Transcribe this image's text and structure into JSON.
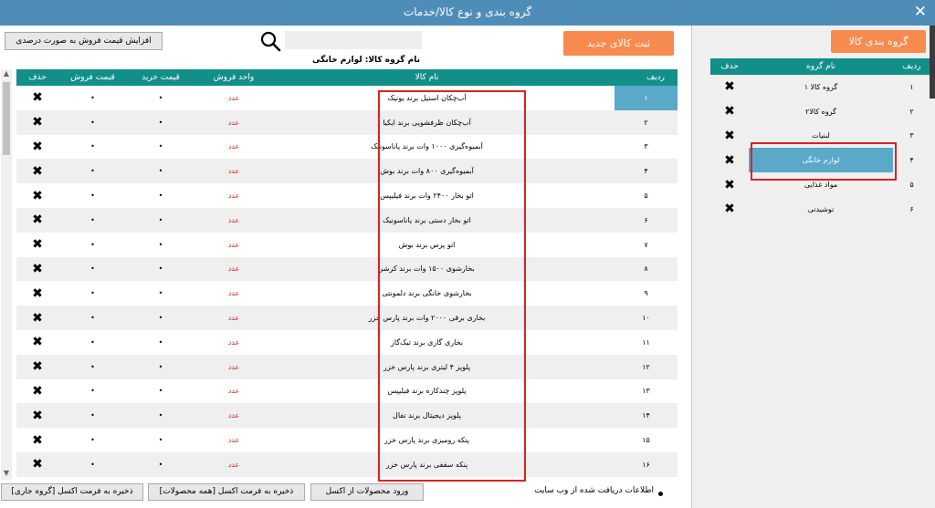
{
  "window": {
    "title": "گروه بندی و نوع کالا/خدمات",
    "close_glyph": "✕"
  },
  "toolbar": {
    "percent_price_button": "افزایش قیمت فروش به صورت درصدی",
    "search_placeholder": "",
    "new_item_button": "ثبت کالای جدید"
  },
  "group_caption": "نام گروه کالا: لوازم خانگی",
  "products_table": {
    "columns": {
      "delete": "حذف",
      "sale_price": "قیمت فروش",
      "buy_price": "قیمت خرید",
      "unit": "واحد فروش",
      "name": "نام کالا",
      "row": "ردیف"
    },
    "rows": [
      {
        "row": "۱",
        "name": "آب‌چکان استیل برند یونیک",
        "unit": "عدد",
        "buy": "•",
        "sale": "•",
        "del": "✖"
      },
      {
        "row": "۲",
        "name": "آب‌چکان ظرفشویی برند ایکیا",
        "unit": "عدد",
        "buy": "•",
        "sale": "•",
        "del": "✖"
      },
      {
        "row": "۳",
        "name": "آبمیوه‌گیری ۱۰۰۰ وات برند پاناسونیک",
        "unit": "عدد",
        "buy": "•",
        "sale": "•",
        "del": "✖"
      },
      {
        "row": "۴",
        "name": "آبمیوه‌گیری ۸۰۰ وات برند بوش",
        "unit": "عدد",
        "buy": "•",
        "sale": "•",
        "del": "✖"
      },
      {
        "row": "۵",
        "name": "اتو بخار ۲۴۰۰ وات برند فیلیپس",
        "unit": "عدد",
        "buy": "•",
        "sale": "•",
        "del": "✖"
      },
      {
        "row": "۶",
        "name": "اتو بخار دستی برند پاناسونیک",
        "unit": "عدد",
        "buy": "•",
        "sale": "•",
        "del": "✖"
      },
      {
        "row": "۷",
        "name": "اتو پرس برند بوش",
        "unit": "عدد",
        "buy": "•",
        "sale": "•",
        "del": "✖"
      },
      {
        "row": "۸",
        "name": "بخارشوی ۱۵۰۰ وات برند کرشر",
        "unit": "عدد",
        "buy": "•",
        "sale": "•",
        "del": "✖"
      },
      {
        "row": "۹",
        "name": "بخارشوی خانگی برند دلمونتی",
        "unit": "عدد",
        "buy": "•",
        "sale": "•",
        "del": "✖"
      },
      {
        "row": "۱۰",
        "name": "بخاری برقی ۲۰۰۰ وات برند پارس خزر",
        "unit": "عدد",
        "buy": "•",
        "sale": "•",
        "del": "✖"
      },
      {
        "row": "۱۱",
        "name": "بخاری گازی برند تیک‌گاز",
        "unit": "عدد",
        "buy": "•",
        "sale": "•",
        "del": "✖"
      },
      {
        "row": "۱۲",
        "name": "پلوپز ۴ لیتری برند پارس خزر",
        "unit": "عدد",
        "buy": "•",
        "sale": "•",
        "del": "✖"
      },
      {
        "row": "۱۳",
        "name": "پلوپز چندکاره برند فیلیپس",
        "unit": "عدد",
        "buy": "•",
        "sale": "•",
        "del": "✖"
      },
      {
        "row": "۱۴",
        "name": "پلوپز دیجیتال برند تفال",
        "unit": "عدد",
        "buy": "•",
        "sale": "•",
        "del": "✖"
      },
      {
        "row": "۱۵",
        "name": "پنکه رومیزی برند پارس خزر",
        "unit": "عدد",
        "buy": "•",
        "sale": "•",
        "del": "✖"
      },
      {
        "row": "۱۶",
        "name": "پنکه سقفی برند پارس خزر",
        "unit": "عدد",
        "buy": "•",
        "sale": "•",
        "del": "✖"
      }
    ]
  },
  "footer": {
    "save_current_group": "ذخیره به فرمت اکسل [گروه جاری]",
    "save_all_products": "ذخیره به فرمت اکسل [همه محصولات]",
    "import_excel": "ورود محصولات از اکسل",
    "web_info": "اطلاعات دریافت شده از وب سایت"
  },
  "groups_panel": {
    "button": "گروه بندی کالا",
    "columns": {
      "delete": "حذف",
      "name": "نام گروه",
      "row": "ردیف"
    },
    "rows": [
      {
        "row": "۱",
        "name": "گروه کالا ۱",
        "del": "✖"
      },
      {
        "row": "۲",
        "name": "گروه کالا۲",
        "del": "✖"
      },
      {
        "row": "۳",
        "name": "لبنیات",
        "del": "✖"
      },
      {
        "row": "۴",
        "name": "لوازم خانگی",
        "del": "✖"
      },
      {
        "row": "۵",
        "name": "مواد غذایی",
        "del": "✖"
      },
      {
        "row": "۶",
        "name": "نوشیدنی",
        "del": "✖"
      }
    ]
  },
  "colors": {
    "title_bar": "#4f8db9",
    "header_teal": "#138f8a",
    "accent_orange": "#f78b4f",
    "selected_blue": "#5aa9c8",
    "highlight_red": "#e02020"
  }
}
